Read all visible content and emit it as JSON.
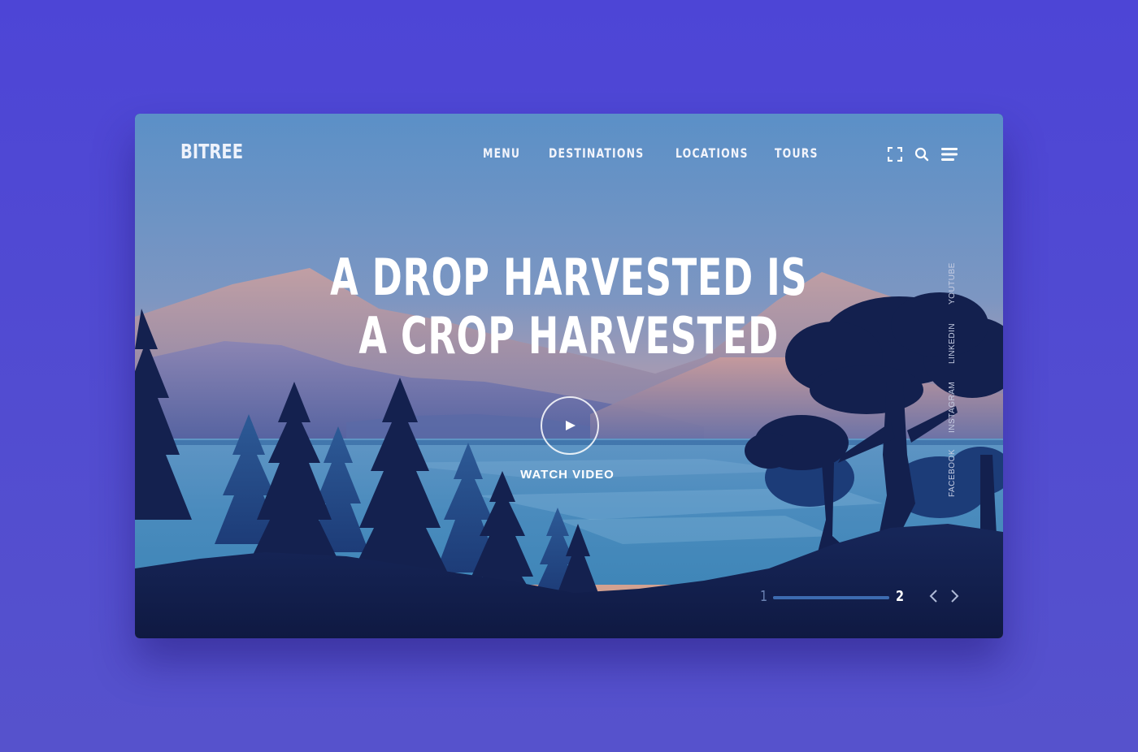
{
  "brand": {
    "logo": "BITREE"
  },
  "nav": {
    "items": [
      {
        "label": "MENU"
      },
      {
        "label": "DESTINATIONS"
      },
      {
        "label": "LOCATIONS"
      },
      {
        "label": "TOURS"
      }
    ]
  },
  "header_icons": [
    "fullscreen-icon",
    "search-icon",
    "hamburger-menu-icon"
  ],
  "hero": {
    "headline_line1": "A DROP HARVESTED IS",
    "headline_line2": "A CROP HARVESTED",
    "watch_label": "WATCH VIDEO"
  },
  "social": {
    "links": [
      {
        "label": "YOUTUBE"
      },
      {
        "label": "LINKEDIN"
      },
      {
        "label": "INSTAGRAM"
      },
      {
        "label": "FACEBOOK"
      }
    ]
  },
  "pager": {
    "current": "1",
    "total": "2",
    "progress": 1.0
  },
  "colors": {
    "page_background": "#4f47d5",
    "sky_top": "#5b8fc6",
    "sky_glow": "#d9a48e",
    "forest_dark": "#13204e",
    "water": "#4d8fc0",
    "text": "#ffffff"
  }
}
